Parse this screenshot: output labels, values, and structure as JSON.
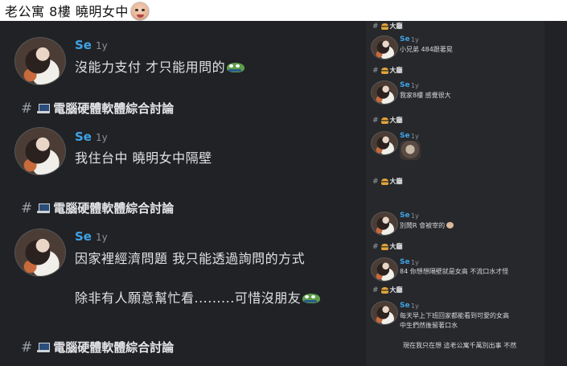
{
  "title": {
    "text": "老公寓 8樓 曉明女中"
  },
  "channel_name": "電腦硬體軟體綜合討論",
  "left_messages": [
    {
      "user": "Se",
      "time": "1y",
      "text": "沒能力支付 才只能用問的"
    },
    {
      "user": "Se",
      "time": "1y",
      "text": "我住台中 曉明女中隔壁"
    },
    {
      "user": "Se",
      "time": "1y",
      "text": "因家裡經濟問題 我只能透過詢問的方式",
      "text2": "除非有人願意幫忙看.........可惜沒朋友"
    }
  ],
  "right_channel_name": "大廳",
  "right_messages": [
    {
      "user": "Se",
      "time": "1y",
      "text": "小兄弟 484跟著晃"
    },
    {
      "user": "Se",
      "time": "1y",
      "text": "我家8樓 感覺很大"
    },
    {
      "user": "Se",
      "time": "1y",
      "text": ""
    },
    {
      "user": "Se",
      "time": "1y",
      "text": "別鬧R 會被宰的"
    },
    {
      "user": "Se",
      "time": "1y",
      "text": "84 你想想隔壁就是女高 不流口水才怪"
    },
    {
      "user": "Se",
      "time": "1y",
      "text": "每天早上下班回家都能看到可愛的女高",
      "text2": "中生們然後留著口水",
      "text3": "現在我只在想 這老公寓千萬別出事 不然"
    }
  ]
}
